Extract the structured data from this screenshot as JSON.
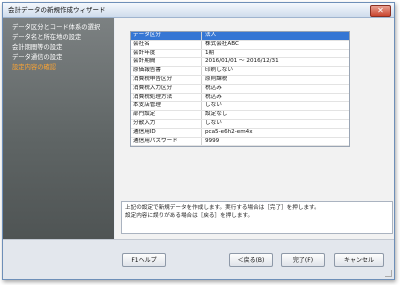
{
  "window": {
    "title": "会計データの新規作成ウィザード",
    "close_glyph": "✕"
  },
  "sidebar": {
    "items": [
      {
        "label": "データ区分とコード体系の選択"
      },
      {
        "label": "データ名と所在地の設定"
      },
      {
        "label": "会計期間等の設定"
      },
      {
        "label": "データ通信の設定"
      },
      {
        "label": "設定内容の確認"
      }
    ],
    "active_color": "#ffa531"
  },
  "summary": {
    "rows": [
      {
        "key": "データ区分",
        "value": "法人"
      },
      {
        "key": "会社名",
        "value": "株式会社ABC"
      },
      {
        "key": "会計年度",
        "value": "1期"
      },
      {
        "key": "会計期間",
        "value": "2016/01/01 ～ 2016/12/31"
      },
      {
        "key": "原価報告書",
        "value": "印刷しない"
      },
      {
        "key": "消費税申告区分",
        "value": "原則課税"
      },
      {
        "key": "消費税入力区分",
        "value": "税込み"
      },
      {
        "key": "消費税処理方法",
        "value": "税込み"
      },
      {
        "key": "本支店管理",
        "value": "しない"
      },
      {
        "key": "部門設定",
        "value": "設定なし"
      },
      {
        "key": "分散入力",
        "value": "しない"
      },
      {
        "key": "通信用ID",
        "value": "pca5-e6h2-em4x"
      },
      {
        "key": "通信用パスワード",
        "value": "9999"
      }
    ],
    "selection_color": "#3576d4"
  },
  "message": {
    "line1": "上記の設定で新規データを作成します。実行する場合は［完了］を押します。",
    "line2": "設定内容に誤りがある場合は［戻る］を押します。"
  },
  "buttons": {
    "help": "F1ヘルプ",
    "back": "＜戻る(B)",
    "finish": "完了(F)",
    "cancel": "キャンセル"
  }
}
